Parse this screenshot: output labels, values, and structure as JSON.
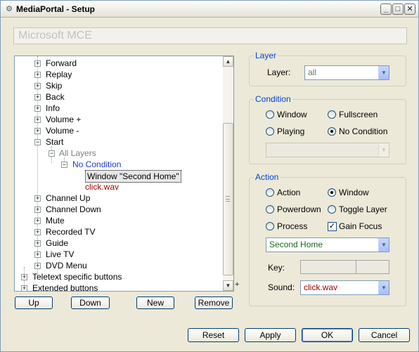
{
  "window": {
    "title": "MediaPortal - Setup",
    "icon": "mediaportal-app-icon",
    "controls": [
      "minimize",
      "maximize",
      "close"
    ]
  },
  "scheme": {
    "value": "Microsoft MCE"
  },
  "tree": {
    "items": [
      {
        "label": "Forward",
        "expander": "+"
      },
      {
        "label": "Replay",
        "expander": "+"
      },
      {
        "label": "Skip",
        "expander": "+"
      },
      {
        "label": "Back",
        "expander": "+"
      },
      {
        "label": "Info",
        "expander": "+"
      },
      {
        "label": "Volume +",
        "expander": "+"
      },
      {
        "label": "Volume -",
        "expander": "+"
      },
      {
        "label": "Start",
        "expander": "−"
      },
      {
        "label": "All Layers",
        "expander": "−"
      },
      {
        "label": "No Condition",
        "expander": "−"
      },
      {
        "label": "Window \"Second Home\"",
        "expander": ""
      },
      {
        "label": "click.wav",
        "expander": ""
      },
      {
        "label": "Channel Up",
        "expander": "+"
      },
      {
        "label": "Channel Down",
        "expander": "+"
      },
      {
        "label": "Mute",
        "expander": "+"
      },
      {
        "label": "Recorded TV",
        "expander": "+"
      },
      {
        "label": "Guide",
        "expander": "+"
      },
      {
        "label": "Live TV",
        "expander": "+"
      },
      {
        "label": "DVD Menu",
        "expander": "+"
      },
      {
        "label": "Teletext specific buttons",
        "expander": "+"
      },
      {
        "label": "Extended buttons",
        "expander": "+"
      }
    ],
    "selected": "Window \"Second Home\"",
    "plus_mark": "+"
  },
  "tree_buttons": {
    "up": "Up",
    "down": "Down",
    "new": "New",
    "remove": "Remove"
  },
  "layer_group": {
    "title": "Layer",
    "label": "Layer:",
    "value": "all"
  },
  "condition_group": {
    "title": "Condition",
    "options": [
      {
        "label": "Window",
        "checked": false
      },
      {
        "label": "Fullscreen",
        "checked": false
      },
      {
        "label": "Playing",
        "checked": false
      },
      {
        "label": "No Condition",
        "checked": true
      }
    ],
    "combo_value": ""
  },
  "action_group": {
    "title": "Action",
    "options": [
      {
        "label": "Action",
        "checked": false
      },
      {
        "label": "Window",
        "checked": true
      },
      {
        "label": "Powerdown",
        "checked": false
      },
      {
        "label": "Toggle Layer",
        "checked": false
      },
      {
        "label": "Process",
        "checked": false
      }
    ],
    "gain_focus": {
      "label": "Gain Focus",
      "checked": true
    },
    "window_value": "Second Home",
    "key_label": "Key:",
    "sound_label": "Sound:",
    "sound_value": "click.wav"
  },
  "footer": {
    "reset": "Reset",
    "apply": "Apply",
    "ok": "OK",
    "cancel": "Cancel"
  },
  "colors": {
    "group_title": "#0046d5",
    "window_bg": "#ece9d8",
    "tree_red": "#a00000",
    "tree_blue": "#1c38d8",
    "combo_green": "#1a6a1a"
  }
}
